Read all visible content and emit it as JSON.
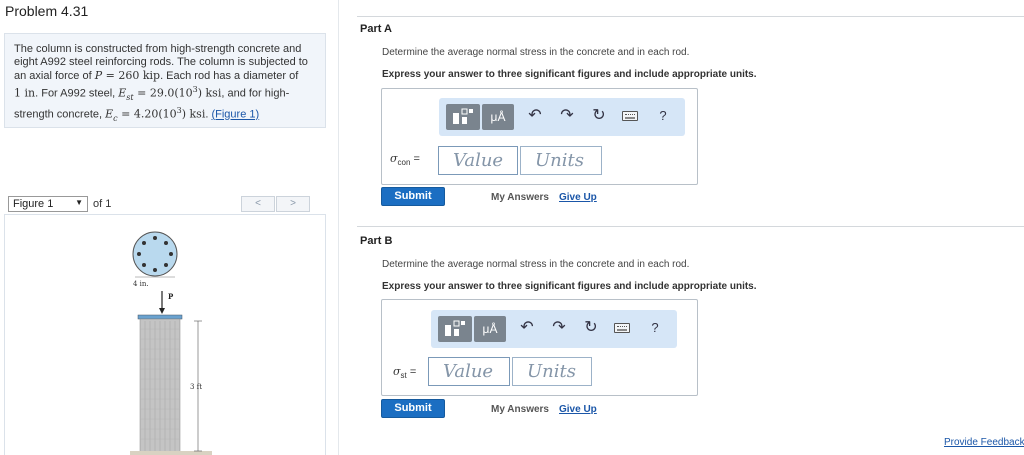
{
  "problem": {
    "title": "Problem 4.31",
    "statement": {
      "line1": "The column is constructed from high-strength concrete and",
      "line2": "eight A992 steel reinforcing rods. The column is subjected to",
      "line3_pre": "an axial force of ",
      "line3_P": "P",
      "line3_eq": " = 260 ",
      "line3_unit": "kip",
      "line3_post": ". Each rod has a diameter of",
      "line4_pre": "1 ",
      "line4_unit": "in",
      "line4_mid": ". For A992 steel, ",
      "line4_E": "E",
      "line4_sub": "st",
      "line4_eq": " = 29.0(10",
      "line4_exp": "3",
      "line4_close": ") ",
      "line4_unit2": "ksi",
      "line4_post": ", and for high-",
      "line5_pre": "strength concrete, ",
      "line5_E": "E",
      "line5_sub": "c",
      "line5_eq": " = 4.20(10",
      "line5_exp": "3",
      "line5_close": ") ",
      "line5_unit": "ksi",
      "line5_dot": ". ",
      "figure_link": "(Figure 1)"
    }
  },
  "figure_nav": {
    "selected": "Figure 1",
    "of_label": "of 1",
    "prev": "<",
    "next": ">"
  },
  "figure": {
    "diameter_label": "4 in.",
    "force_label": "P",
    "height_label": "3 ft",
    "rod_count": 8
  },
  "parts": [
    {
      "title": "Part A",
      "instruction": "Determine the average normal stress in the concrete and in each rod.",
      "format_instruction": "Express your answer to three significant figures and include appropriate units.",
      "var_symbol": "σ",
      "var_sub": "con",
      "eq": "=",
      "value_placeholder": "Value",
      "units_placeholder": "Units",
      "submit": "Submit",
      "my_answers": "My Answers",
      "give_up": "Give Up"
    },
    {
      "title": "Part B",
      "instruction": "Determine the average normal stress in the concrete and in each rod.",
      "format_instruction": "Express your answer to three significant figures and include appropriate units.",
      "var_symbol": "σ",
      "var_sub": "st",
      "eq": "=",
      "value_placeholder": "Value",
      "units_placeholder": "Units",
      "submit": "Submit",
      "my_answers": "My Answers",
      "give_up": "Give Up"
    }
  ],
  "toolbar": {
    "templates_icon": "templates-icon",
    "units_label": "μÅ",
    "undo_icon": "undo-icon",
    "redo_icon": "redo-icon",
    "reset_icon": "reset-icon",
    "keyboard_icon": "keyboard-icon",
    "help_label": "?"
  },
  "footer": {
    "feedback": "Provide Feedback"
  }
}
